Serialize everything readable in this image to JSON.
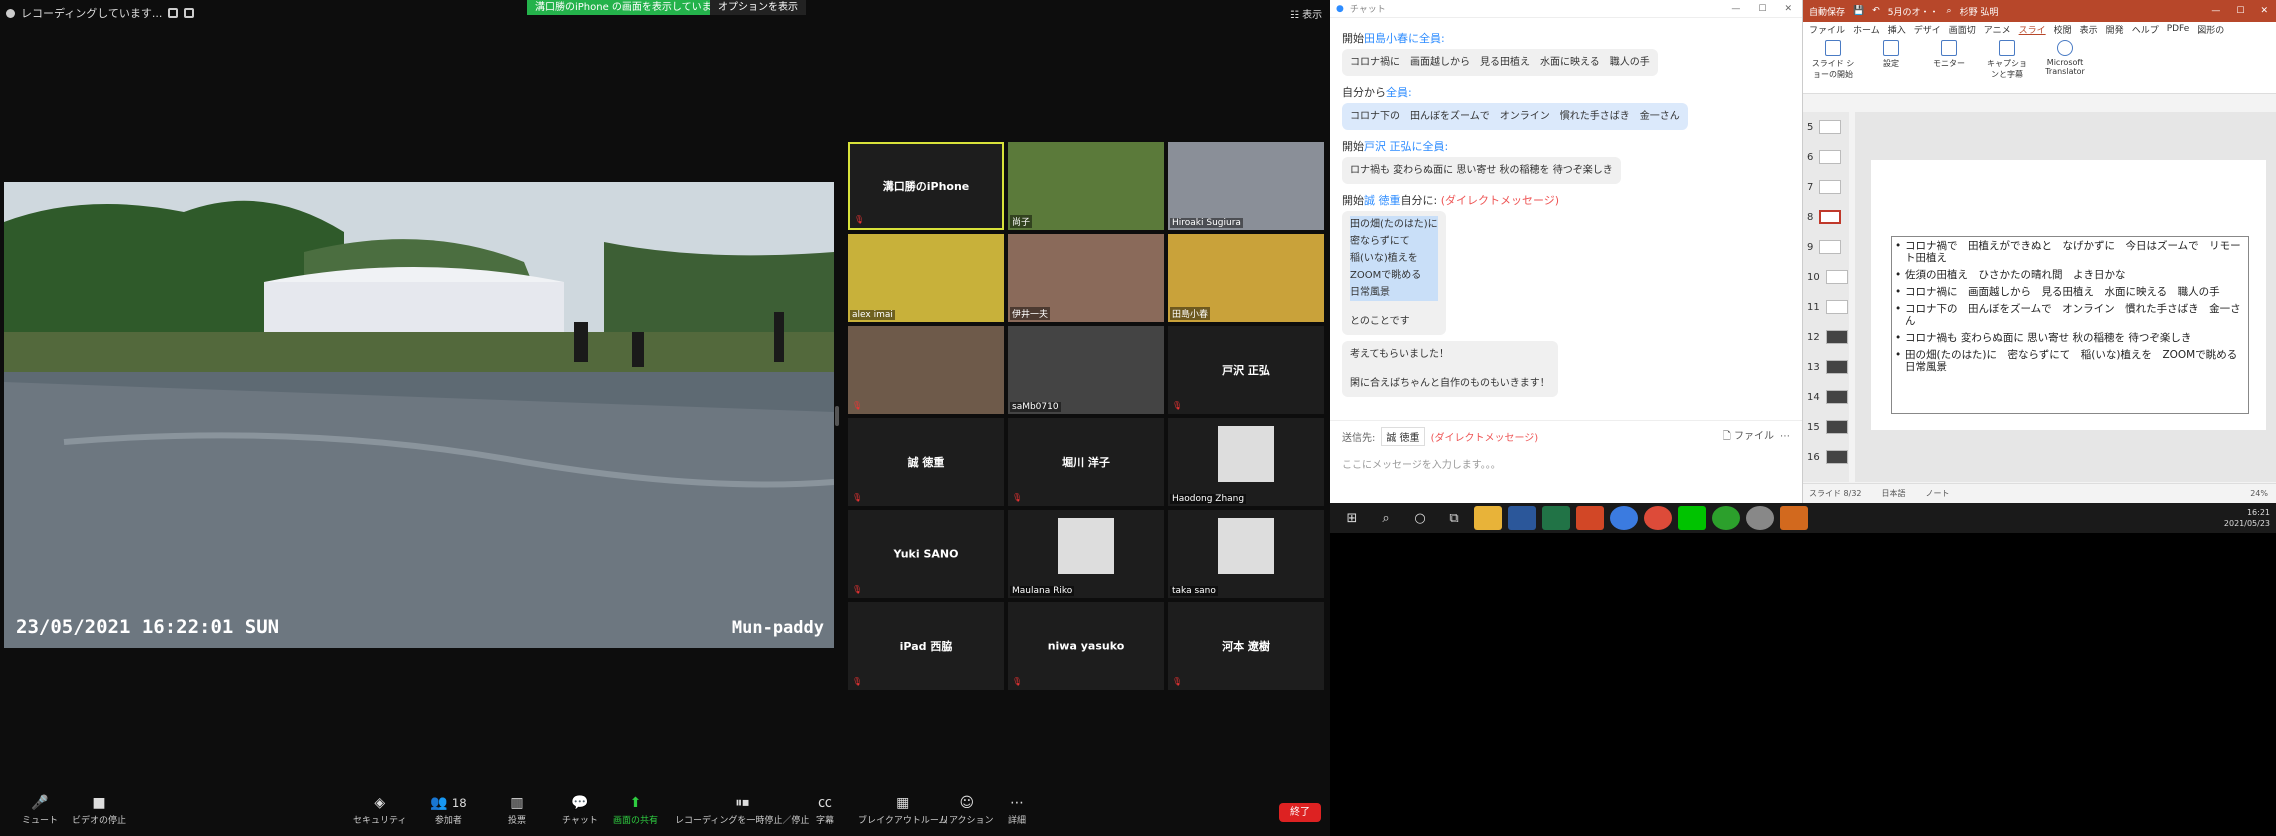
{
  "zoom": {
    "recording_status": "レコーディングしています...",
    "share_banner": "溝口勝のiPhone の画面を表示しています",
    "share_options": "オプションを表示",
    "view_label": "表示",
    "video": {
      "timestamp": "23/05/2021 16:22:01 SUN",
      "camera_label": "Mun-paddy"
    },
    "participants": [
      {
        "name": "溝口勝のiPhone",
        "type": "name",
        "active": true
      },
      {
        "name": "尚子",
        "type": "photo"
      },
      {
        "name": "Hiroaki Sugiura",
        "type": "photo"
      },
      {
        "name": "alex imai",
        "type": "photo"
      },
      {
        "name": "伊井一夫",
        "type": "photo"
      },
      {
        "name": "田島小春",
        "type": "photo"
      },
      {
        "name": "",
        "type": "photo"
      },
      {
        "name": "saMb0710",
        "type": "photo"
      },
      {
        "name": "戸沢 正弘",
        "type": "name"
      },
      {
        "name": "誠 徳重",
        "type": "name"
      },
      {
        "name": "堀川 洋子",
        "type": "name"
      },
      {
        "name": "Haodong Zhang",
        "type": "avatar"
      },
      {
        "name": "Yuki SANO",
        "type": "name"
      },
      {
        "name": "Maulana Riko",
        "type": "avatar"
      },
      {
        "name": "taka sano",
        "type": "avatar"
      },
      {
        "name": "iPad 西脇",
        "type": "name"
      },
      {
        "name": "niwa yasuko",
        "type": "name"
      },
      {
        "name": "河本 遼樹",
        "type": "name"
      }
    ],
    "toolbar": {
      "mute": "ミュート",
      "video": "ビデオの停止",
      "security": "セキュリティ",
      "participants": "参加者",
      "participants_count": "18",
      "poll": "投票",
      "chat": "チャット",
      "share": "画面の共有",
      "recording": "レコーディングを一時停止／停止",
      "captions": "字幕",
      "breakout": "ブレイクアウトルーム",
      "reactions": "リアクション",
      "more": "詳細",
      "end": "終了"
    }
  },
  "chat": {
    "title": "チャット",
    "messages": [
      {
        "from": "開始",
        "to": "田島小春に全員:",
        "text": "コロナ禍に　画面越しから　見る田植え　水面に映える　職人の手"
      },
      {
        "from": "自分から",
        "to": "全員:",
        "text": "コロナ下の　田んぼをズームで　オンライン　慣れた手さばき　金一さん"
      },
      {
        "from": "開始",
        "to": "戸沢 正弘に全員:",
        "text": "ロナ禍も 変わらぬ面に 思い寄せ 秋の稲穂を 待つぞ楽しき"
      },
      {
        "from": "開始",
        "to": "誠 徳重",
        "dm_target": "自分に:",
        "dm": "(ダイレクトメッセージ)"
      }
    ],
    "poem_lines": [
      "田の畑(たのはた)に",
      "密ならずにて",
      "稲(いな)植えを",
      "ZOOMで眺める",
      "日常風景"
    ],
    "poem_tail": "とのことです",
    "reply_1": "考えてもらいました！",
    "reply_2": "閑に合えばちゃんと自作のものもいきます！",
    "send_to_label": "送信先:",
    "send_to_value": "誠 徳重",
    "send_to_dm": "(ダイレクトメッセージ)",
    "file_label": "ファイル",
    "input_placeholder": "ここにメッセージを入力します。。。"
  },
  "powerpoint": {
    "autosave": "自動保存",
    "doc_name": "5月のオ・・",
    "user": "杉野 弘明",
    "tabs": [
      "ファイル",
      "ホーム",
      "挿入",
      "デザイ",
      "画面切",
      "アニメ",
      "スライ",
      "校閲",
      "表示",
      "開発",
      "ヘルプ",
      "PDFe",
      "図形の"
    ],
    "ribbon": [
      "スライド ショーの開始",
      "設定",
      "モニター",
      "キャプションと字幕",
      "Microsoft Translator"
    ],
    "thumb_numbers": [
      "5",
      "6",
      "7",
      "8",
      "9",
      "10",
      "11",
      "12",
      "13",
      "14",
      "15",
      "16"
    ],
    "bullets": [
      "コロナ禍で　田植えができぬと　なげかずに　今日はズームで　リモート田植え",
      "佐須の田植え　ひさかたの晴れ間　よき日かな",
      "コロナ禍に　画面越しから　見る田植え　水面に映える　職人の手",
      "コロナ下の　田んぼをズームで　オンライン　慣れた手さばき　金一さん",
      "コロナ禍も 変わらぬ面に 思い寄せ 秋の稲穂を 待つぞ楽しき",
      "田の畑(たのはた)に　密ならずにて　稲(いな)植えを　ZOOMで眺める　日常風景"
    ],
    "status_slide": "スライド 8/32",
    "status_lang": "日本語",
    "status_notes": "ノート",
    "zoom_level": "24%"
  },
  "taskbar": {
    "time": "16:21",
    "date": "2021/05/23"
  }
}
